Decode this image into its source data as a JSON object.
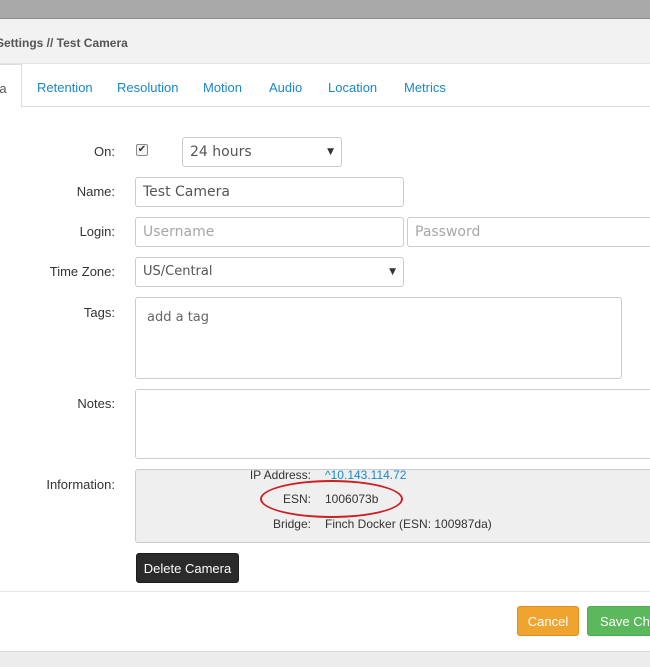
{
  "modal": {
    "title": "Settings // Test Camera"
  },
  "tabs": [
    {
      "label": "ra"
    },
    {
      "label": "Retention"
    },
    {
      "label": "Resolution"
    },
    {
      "label": "Motion"
    },
    {
      "label": "Audio"
    },
    {
      "label": "Location"
    },
    {
      "label": "Metrics"
    }
  ],
  "form": {
    "on_label": "On:",
    "on_checked": true,
    "on_checkmark": "✔",
    "schedule_value": "24 hours",
    "name_label": "Name:",
    "name_value": "Test Camera",
    "login_label": "Login:",
    "username_placeholder": "Username",
    "password_placeholder": "Password",
    "timezone_label": "Time Zone:",
    "timezone_value": "US/Central",
    "tags_label": "Tags:",
    "tags_placeholder": "add a tag",
    "notes_label": "Notes:",
    "notes_value": "",
    "information_label": "Information:",
    "caret": "▼"
  },
  "information": {
    "ip_label": "IP Address:",
    "ip_value": "^10.143.114.72",
    "esn_label": "ESN:",
    "esn_value": "1006073b",
    "bridge_label": "Bridge:",
    "bridge_value": "Finch Docker (ESN: 100987da)"
  },
  "buttons": {
    "delete": "Delete Camera",
    "cancel": "Cancel",
    "save": "Save Changes"
  },
  "colors": {
    "link": "#1a87c9",
    "annotation": "#cc1f1f",
    "cancel": "#f0a430",
    "save": "#5cb85c",
    "delete": "#2b2b2b"
  }
}
